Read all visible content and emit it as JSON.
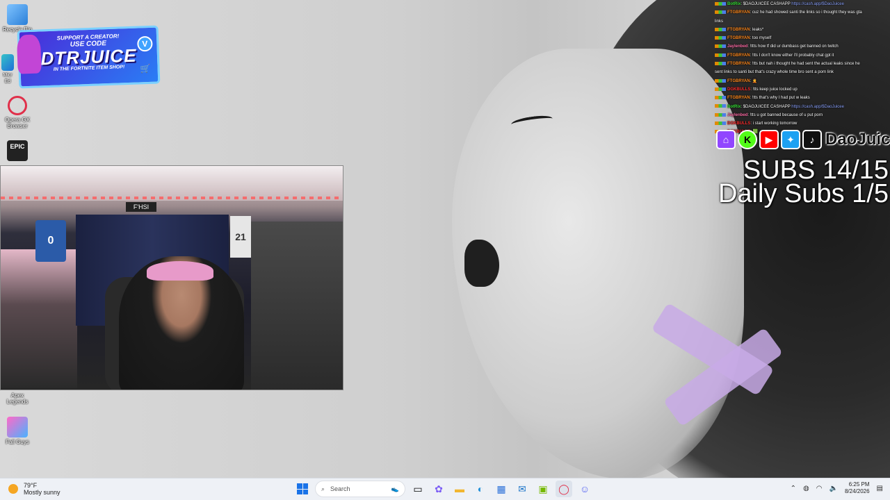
{
  "desktop": {
    "icons": [
      {
        "label": "Recycle Bin",
        "name": "recycle-bin"
      },
      {
        "label": "Micr Ed",
        "name": "microsoft-edge"
      },
      {
        "label": "Opera GX Browser",
        "name": "opera-gx"
      },
      {
        "label": "Epic Games",
        "name": "epic-games"
      },
      {
        "label": "Apex Legends",
        "name": "apex-legends"
      },
      {
        "label": "Fall Guys",
        "name": "fall-guys"
      }
    ]
  },
  "promo": {
    "line1": "SUPPORT A CREATOR!",
    "line2": "USE CODE",
    "code": "DTRJUICE",
    "line4": "IN THE FORTNITE ITEM SHOP!",
    "badge": "V"
  },
  "webcam": {
    "sign": "F'HSI",
    "jersey1": "0",
    "jersey2": "21"
  },
  "chat": [
    {
      "user": "BotRix",
      "color": "#38e038",
      "text": ": $DAOJUICEE CASHAPP ",
      "link": "https://cash.app/$DaoJuicee"
    },
    {
      "user": "FTGBRYAN",
      "color": "#ff8a1f",
      "text": ": cuz he had showed santi the links so i thought they was gta",
      "link": ""
    },
    {
      "user": "",
      "color": "#ffffff",
      "text": "links",
      "link": ""
    },
    {
      "user": "FTGBRYAN",
      "color": "#ff8a1f",
      "text": ": leaks*",
      "link": ""
    },
    {
      "user": "FTGBRYAN",
      "color": "#ff8a1f",
      "text": ": too myself",
      "link": ""
    },
    {
      "user": "Jaylenbed",
      "color": "#ff6fa8",
      "text": ": !ttts how tf did ur dumbass get banned on twitch",
      "link": ""
    },
    {
      "user": "FTGBRYAN",
      "color": "#ff8a1f",
      "text": ": !tts I don't know either i'll probably chat gpt it",
      "link": ""
    },
    {
      "user": "FTGBRYAN",
      "color": "#ff8a1f",
      "text": ": !tts but nah i thought he had sent the actual leaks since he",
      "link": ""
    },
    {
      "user": "",
      "color": "#ffffff",
      "text": "sent links to santi but that's crazy whole time bro sent a porn link",
      "link": ""
    },
    {
      "user": "FTGBRYAN",
      "color": "#ff8a1f",
      "text": ": 🤦",
      "link": ""
    },
    {
      "user": "DGKBULLS",
      "color": "#ff3030",
      "text": ": !tts keep juice locked up",
      "link": ""
    },
    {
      "user": "FTGBRYAN",
      "color": "#ff8a1f",
      "text": ": !tts that's why I had put w leaks",
      "link": ""
    },
    {
      "user": "BotRix",
      "color": "#38e038",
      "text": ": $DAOJUICEE CASHAPP ",
      "link": "https://cash.app/$DaoJuicee"
    },
    {
      "user": "Jaylenbed",
      "color": "#ff6fa8",
      "text": ": !tts u got banned because of u put porn",
      "link": ""
    },
    {
      "user": "DGKBULLS",
      "color": "#ff3030",
      "text": ": i start working tomorrow",
      "link": ""
    },
    {
      "user": "DGKBULLS",
      "color": "#ff3030",
      "text": ": 🟩",
      "link": ""
    }
  ],
  "socials": {
    "handle": "DaoJuice",
    "icons": [
      "twitch-icon",
      "kick-icon",
      "youtube-icon",
      "twitter-icon",
      "tiktok-icon"
    ]
  },
  "goals": {
    "subs": "SUBS 14/15",
    "daily": "Daily Subs  1/5"
  },
  "taskbar": {
    "weather_temp": "79°F",
    "weather_desc": "Mostly sunny",
    "search_placeholder": "Search",
    "time": "6:25 PM",
    "date": "8/24/2026"
  }
}
